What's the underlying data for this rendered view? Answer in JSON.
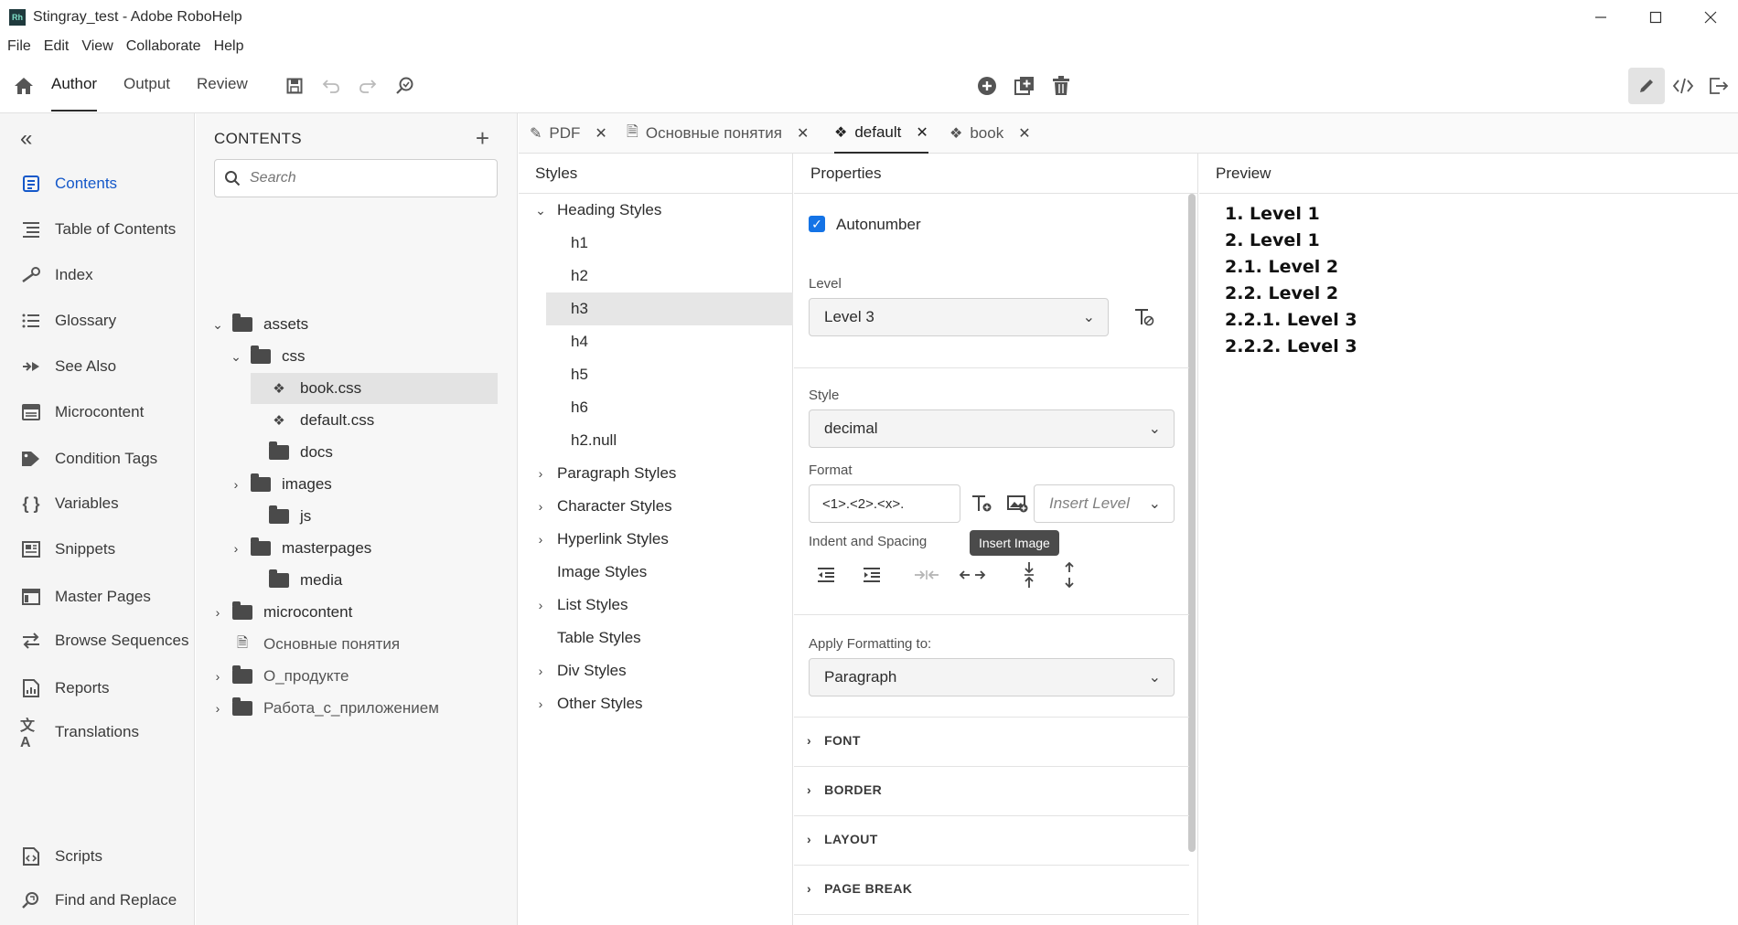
{
  "window": {
    "app_logo": "Rh",
    "title": "Stingray_test - Adobe RoboHelp",
    "controls": [
      "minimize-icon",
      "maximize-icon",
      "close-icon"
    ]
  },
  "menu": [
    "File",
    "Edit",
    "View",
    "Collaborate",
    "Help"
  ],
  "toolbar": {
    "modes": [
      "Author",
      "Output",
      "Review"
    ],
    "active_mode": "Author"
  },
  "leftnav": {
    "items": [
      {
        "label": "Contents",
        "icon": "contents-icon",
        "active": true
      },
      {
        "label": "Table of Contents",
        "icon": "toc-icon"
      },
      {
        "label": "Index",
        "icon": "index-icon"
      },
      {
        "label": "Glossary",
        "icon": "glossary-icon"
      },
      {
        "label": "See Also",
        "icon": "see-also-icon"
      },
      {
        "label": "Microcontent",
        "icon": "microcontent-icon"
      },
      {
        "label": "Condition Tags",
        "icon": "tag-icon"
      },
      {
        "label": "Variables",
        "icon": "variables-icon"
      },
      {
        "label": "Snippets",
        "icon": "snippets-icon"
      },
      {
        "label": "Master Pages",
        "icon": "master-pages-icon"
      },
      {
        "label": "Browse Sequences",
        "icon": "browse-sequences-icon"
      },
      {
        "label": "Reports",
        "icon": "reports-icon"
      },
      {
        "label": "Translations",
        "icon": "translations-icon"
      },
      {
        "label": "Scripts",
        "icon": "scripts-icon"
      },
      {
        "label": "Find and Replace",
        "icon": "find-replace-icon"
      }
    ]
  },
  "contents": {
    "title": "CONTENTS",
    "search_placeholder": "Search",
    "tree": [
      {
        "label": "assets",
        "type": "folder",
        "expanded": true
      },
      {
        "label": "css",
        "type": "folder",
        "expanded": true
      },
      {
        "label": "book.css",
        "type": "css",
        "selected": true
      },
      {
        "label": "default.css",
        "type": "css"
      },
      {
        "label": "docs",
        "type": "folder"
      },
      {
        "label": "images",
        "type": "folder",
        "expandable": true
      },
      {
        "label": "js",
        "type": "folder"
      },
      {
        "label": "masterpages",
        "type": "folder",
        "expandable": true
      },
      {
        "label": "media",
        "type": "folder"
      },
      {
        "label": "microcontent",
        "type": "folder",
        "expandable": true
      },
      {
        "label": "Основные понятия",
        "type": "topic"
      },
      {
        "label": "О_продукте",
        "type": "folder",
        "expandable": true
      },
      {
        "label": "Работа_с_приложением",
        "type": "folder",
        "expandable": true
      }
    ]
  },
  "tabs": [
    {
      "label": "PDF",
      "icon": "pdf-template-icon"
    },
    {
      "label": "Основные понятия",
      "icon": "topic-icon"
    },
    {
      "label": "default",
      "icon": "stylesheet-icon",
      "active": true
    },
    {
      "label": "book",
      "icon": "stylesheet-icon"
    }
  ],
  "styles": {
    "title": "Styles",
    "items": [
      {
        "label": "Heading Styles",
        "expandable": true,
        "expanded": true
      },
      {
        "label": "h1",
        "child": true
      },
      {
        "label": "h2",
        "child": true
      },
      {
        "label": "h3",
        "child": true,
        "selected": true
      },
      {
        "label": "h4",
        "child": true
      },
      {
        "label": "h5",
        "child": true
      },
      {
        "label": "h6",
        "child": true
      },
      {
        "label": "h2.null",
        "child": true
      },
      {
        "label": "Paragraph Styles",
        "expandable": true
      },
      {
        "label": "Character Styles",
        "expandable": true
      },
      {
        "label": "Hyperlink Styles",
        "expandable": true
      },
      {
        "label": "Image Styles"
      },
      {
        "label": "List Styles",
        "expandable": true
      },
      {
        "label": "Table Styles"
      },
      {
        "label": "Div Styles",
        "expandable": true
      },
      {
        "label": "Other Styles",
        "expandable": true
      }
    ]
  },
  "properties": {
    "title": "Properties",
    "autonumber_label": "Autonumber",
    "autonumber_checked": true,
    "level_label": "Level",
    "level_value": "Level 3",
    "style_label": "Style",
    "style_value": "decimal",
    "format_label": "Format",
    "format_value": "<1>.<2>.<x>.",
    "insert_level_placeholder": "Insert Level",
    "tooltip": "Insert Image",
    "indent_label": "Indent and Spacing",
    "apply_label": "Apply Formatting to:",
    "apply_value": "Paragraph",
    "sections": [
      "FONT",
      "BORDER",
      "LAYOUT",
      "PAGE BREAK"
    ]
  },
  "preview": {
    "title": "Preview",
    "lines": [
      "1. Level 1",
      "2. Level 1",
      "2.1. Level 2",
      "2.2. Level 2",
      "2.2.1. Level 3",
      "2.2.2. Level 3"
    ]
  }
}
